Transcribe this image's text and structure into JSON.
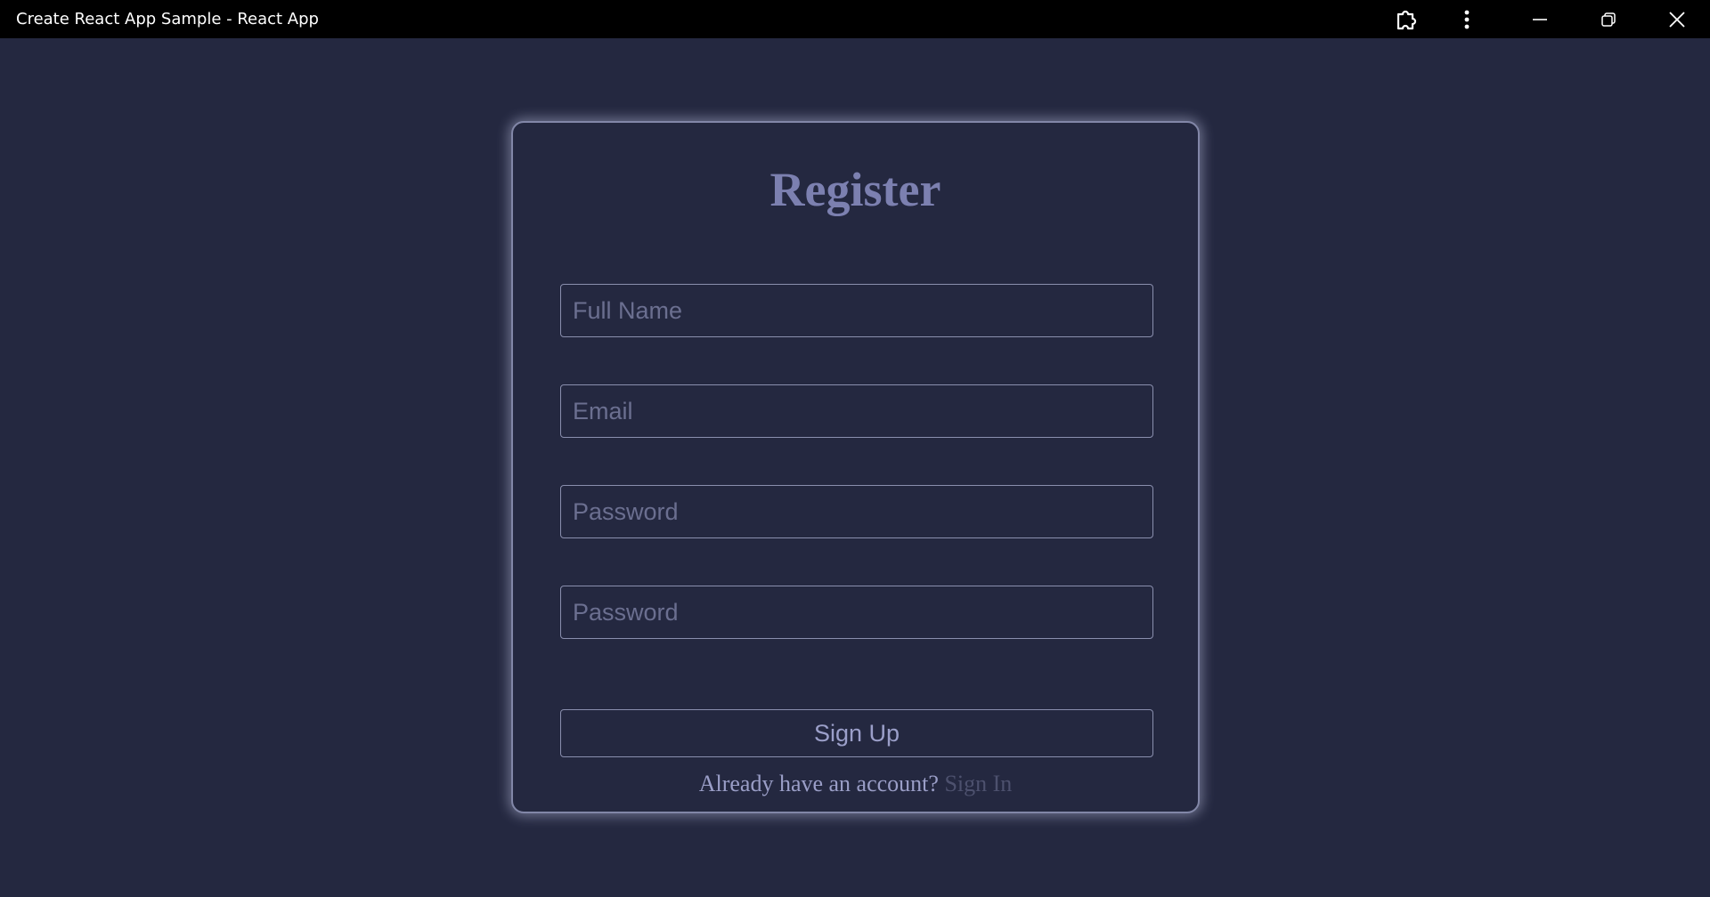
{
  "window": {
    "title": "Create React App Sample - React App",
    "controls": {
      "extension_icon": "puzzle-icon",
      "menu_icon": "more-vertical-icon",
      "minimize_icon": "minimize-icon",
      "restore_icon": "restore-icon",
      "close_icon": "close-icon"
    }
  },
  "form": {
    "heading": "Register",
    "fields": {
      "full_name_placeholder": "Full Name",
      "email_placeholder": "Email",
      "password_placeholder": "Password",
      "confirm_password_placeholder": "Password"
    },
    "submit_label": "Sign Up",
    "footer_text": "Already have an account?",
    "footer_link": "Sign In"
  },
  "colors": {
    "background": "#242840",
    "heading": "#7c80b0",
    "border": "#8a8fae",
    "link": "#4d516e"
  }
}
